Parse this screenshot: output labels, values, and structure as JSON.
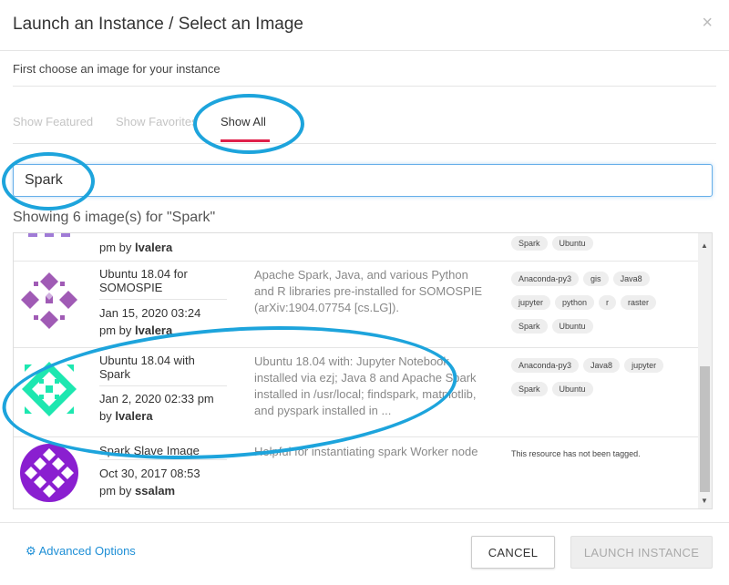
{
  "modal": {
    "title": "Launch an Instance / Select an Image",
    "close": "×",
    "subtitle": "First choose an image for your instance"
  },
  "tabs": [
    "Show Featured",
    "Show Favorites",
    "Show All"
  ],
  "active_tab": "Show All",
  "search": {
    "value": "Spark"
  },
  "results_text": "Showing 6 image(s) for \"Spark\"",
  "partial_row": {
    "date_tail": "pm by ",
    "author": "lvalera",
    "tags": [
      "Spark",
      "Ubuntu"
    ]
  },
  "rows": [
    {
      "name": "Ubuntu 18.04 for SOMOSPIE",
      "date": "Jan 15, 2020 03:24",
      "date_tail": "pm by ",
      "author": "lvalera",
      "description": "Apache Spark, Java, and various Python and R libraries pre-installed for SOMOSPIE (arXiv:1904.07754 [cs.LG]).",
      "tags": [
        "Anaconda-py3",
        "gis",
        "Java8",
        "jupyter",
        "python",
        "r",
        "raster",
        "Spark",
        "Ubuntu"
      ],
      "avatar_color": "#a05bb5"
    },
    {
      "name": "Ubuntu 18.04 with Spark",
      "date": "Jan 2, 2020 02:33 pm",
      "date_tail": "by ",
      "author": "lvalera",
      "description": "Ubuntu 18.04 with: Jupyter Notebook installed via ezj; Java 8 and Apache Spark installed in /usr/local; findspark, matplotlib, and pyspark installed in ...",
      "tags": [
        "Anaconda-py3",
        "Java8",
        "jupyter",
        "Spark",
        "Ubuntu"
      ],
      "avatar_color": "#1de7b0"
    },
    {
      "name": "Spark Slave Image",
      "date": "Oct 30, 2017 08:53",
      "date_tail": "pm by ",
      "author": "ssalam",
      "description": "Helpful for instantiating spark Worker node",
      "tags": [],
      "no_tags_text": "This resource has not been tagged.",
      "avatar_color": "#8a1fd0"
    }
  ],
  "footer": {
    "advanced": "Advanced Options",
    "cancel": "CANCEL",
    "launch": "LAUNCH INSTANCE"
  },
  "colors": {
    "accent": "#e0204a",
    "link": "#1e8fd6",
    "annotation": "#1da4dc"
  }
}
